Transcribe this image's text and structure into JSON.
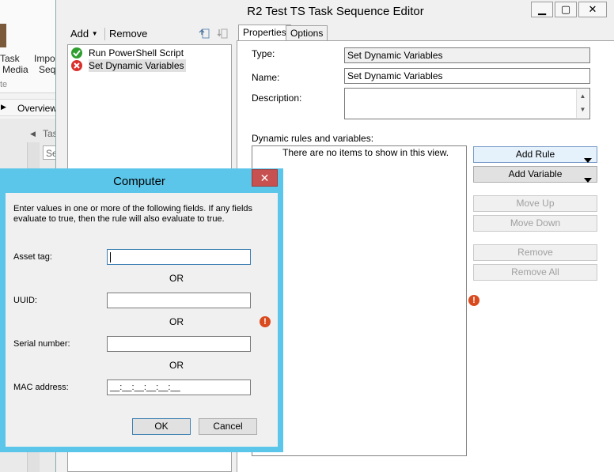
{
  "background": {
    "ribbon_items": [
      {
        "line1": "Task",
        "line2": "Media"
      },
      {
        "line1": "Impo",
        "line2": "Seq"
      }
    ],
    "group_label": "te",
    "nav_label": "Overview",
    "pane_label": "Tas",
    "pane_search": "Se"
  },
  "editor": {
    "title": "R2 Test TS Task Sequence Editor",
    "window_buttons": {
      "minimize": "▁",
      "maximize": "▢",
      "close": "✕"
    },
    "toolbar": {
      "add_label": "Add",
      "remove_label": "Remove"
    },
    "tree": [
      {
        "label": "Run PowerShell Script",
        "status": "ok"
      },
      {
        "label": "Set Dynamic Variables",
        "status": "error"
      }
    ],
    "tabs": [
      {
        "label": "Properties",
        "active": true
      },
      {
        "label": "Options",
        "active": false
      }
    ],
    "properties": {
      "type_label": "Type:",
      "type_value": "Set Dynamic Variables",
      "name_label": "Name:",
      "name_value": "Set Dynamic Variables",
      "description_label": "Description:",
      "description_value": "",
      "rules_label": "Dynamic rules and variables:",
      "rules_empty_text": "There are no items to show in this view."
    },
    "buttons": {
      "add_rule": "Add Rule",
      "add_variable": "Add Variable",
      "move_up": "Move Up",
      "move_down": "Move Down",
      "remove": "Remove",
      "remove_all": "Remove All"
    },
    "error_glyph": "!"
  },
  "dialog": {
    "title": "Computer",
    "close_glyph": "✕",
    "instructions_line1": "Enter values in one or more of the following fields. If any fields",
    "instructions_line2": "evaluate to true, then the rule will also evaluate to true.",
    "asset_tag_label": "Asset tag:",
    "asset_tag_value": "",
    "or_text": "OR",
    "uuid_label": "UUID:",
    "uuid_value": "",
    "serial_label": "Serial number:",
    "serial_value": "",
    "mac_label": "MAC address:",
    "mac_value": "__:__:__:__:__:__",
    "ok_label": "OK",
    "cancel_label": "Cancel"
  },
  "colors": {
    "dialog_frame": "#5bc6ea",
    "close_button": "#c75050",
    "error_icon": "#d94a1e",
    "success_icon": "#2e9e2e"
  }
}
